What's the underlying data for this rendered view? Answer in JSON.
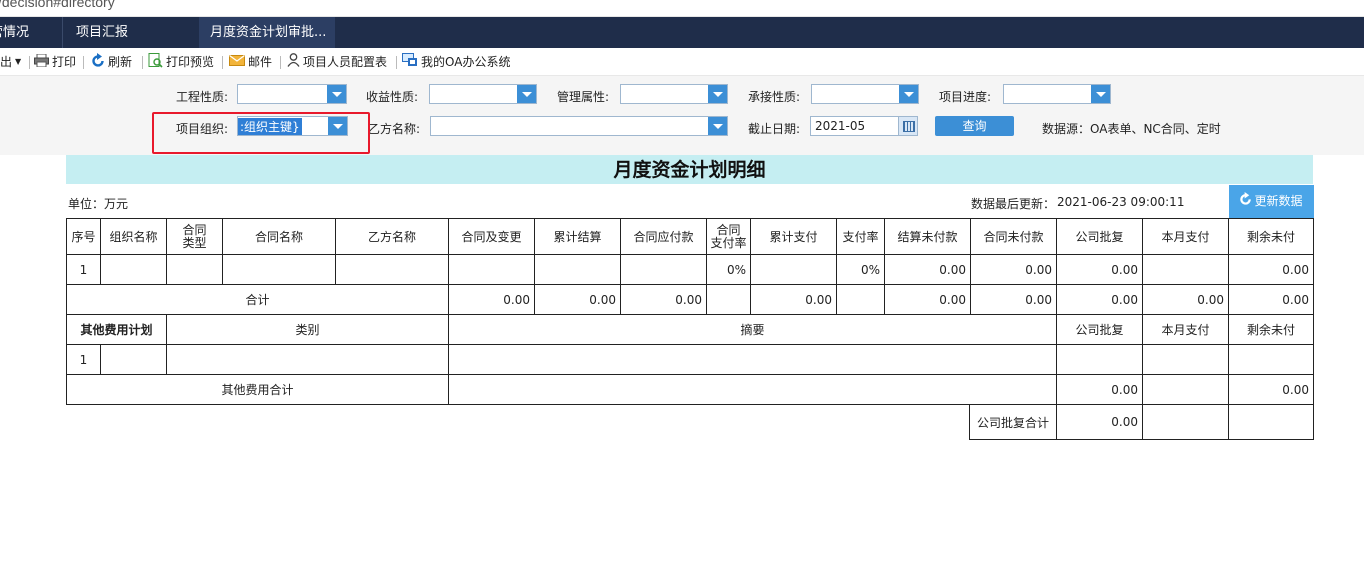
{
  "browser": {
    "url_fragment": "/decision#directory"
  },
  "tabs": [
    {
      "label": "营情况"
    },
    {
      "label": "项目汇报"
    },
    {
      "label": "月度资金计划审批..."
    }
  ],
  "toolbar": {
    "export_label": "出",
    "print_label": "打印",
    "refresh_label": "刷新",
    "print_preview_label": "打印预览",
    "mail_label": "邮件",
    "staff_config_label": "项目人员配置表",
    "oa_label": "我的OA办公系统"
  },
  "filters": {
    "engineering_nature_label": "工程性质:",
    "revenue_nature_label": "收益性质:",
    "management_attr_label": "管理属性:",
    "contract_nature_label": "承接性质:",
    "project_progress_label": "项目进度:",
    "project_org_label": "项目组织:",
    "project_org_value": ":组织主键}",
    "party_b_label": "乙方名称:",
    "deadline_label": "截止日期:",
    "deadline_value": "2021-05",
    "query_button": "查询",
    "data_source": "数据源：OA表单、NC合同、定时"
  },
  "report": {
    "title": "月度资金计划明细",
    "unit": "单位：万元",
    "last_update_label": "数据最后更新：",
    "last_update_value": "2021-06-23 09:00:11",
    "update_button": "更新数据",
    "headers": {
      "seq": "序号",
      "org": "组织名称",
      "contract_type_1": "合同",
      "contract_type_2": "类型",
      "contract_name": "合同名称",
      "party_b": "乙方名称",
      "contract_change": "合同及变更",
      "cum_settle": "累计结算",
      "contract_payable": "合同应付款",
      "pay_rate_1": "合同",
      "pay_rate_2": "支付率",
      "cum_pay": "累计支付",
      "pay_ratio": "支付率",
      "settle_unpaid": "结算未付款",
      "contract_unpaid": "合同未付款",
      "company_approval": "公司批复",
      "month_pay": "本月支付",
      "remaining_unpaid": "剩余未付"
    },
    "row1": {
      "seq": "1",
      "contract_pay_rate": "0%",
      "pay_ratio": "0%",
      "settle_unpaid": "0.00",
      "contract_unpaid": "0.00",
      "company_approval": "0.00",
      "remaining_unpaid": "0.00"
    },
    "total": {
      "label": "合计",
      "contract_change": "0.00",
      "cum_settle": "0.00",
      "contract_payable": "0.00",
      "cum_pay": "0.00",
      "settle_unpaid": "0.00",
      "contract_unpaid": "0.00",
      "company_approval": "0.00",
      "month_pay": "0.00",
      "remaining_unpaid": "0.00"
    },
    "other": {
      "header": "其他费用计划",
      "category": "类别",
      "summary": "摘要",
      "company_approval": "公司批复",
      "month_pay": "本月支付",
      "remaining_unpaid": "剩余未付",
      "row_seq": "1",
      "total_label": "其他费用合计",
      "total_company_approval": "0.00",
      "total_remaining_unpaid": "0.00"
    },
    "approval_total_label": "公司批复合计",
    "approval_total_value": "0.00"
  }
}
